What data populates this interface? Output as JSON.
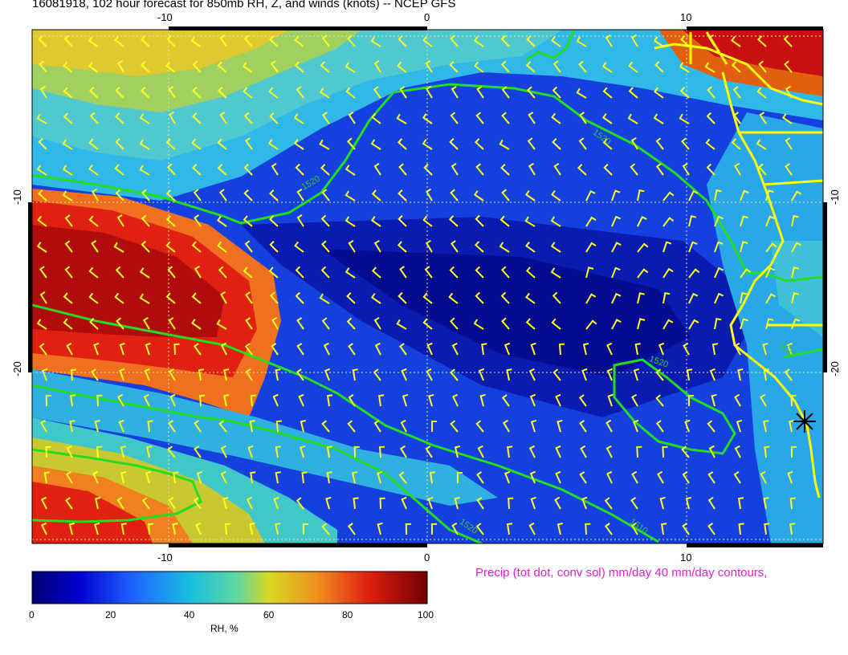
{
  "title": "16081918, 102 hour forecast for 850mb RH, Z, and winds (knots)  -- NCEP GFS",
  "axes": {
    "lon_ticks": [
      "-10",
      "0",
      "10"
    ],
    "lat_ticks": [
      "-10",
      "-20"
    ]
  },
  "contour_labels": [
    "1520",
    "1520",
    "1520",
    "1520",
    "1520",
    "1510"
  ],
  "precip_note": "Precip (tot dot, conv sol) mm/day 40 mm/day contours,",
  "colorbar": {
    "title": "RH, %",
    "ticks": [
      "0",
      "20",
      "40",
      "60",
      "80",
      "100"
    ],
    "colors": [
      "#000080",
      "#0000cc",
      "#1a5cff",
      "#19b4e6",
      "#40d9c0",
      "#c8d830",
      "#f0a020",
      "#e03010",
      "#800000"
    ]
  }
}
